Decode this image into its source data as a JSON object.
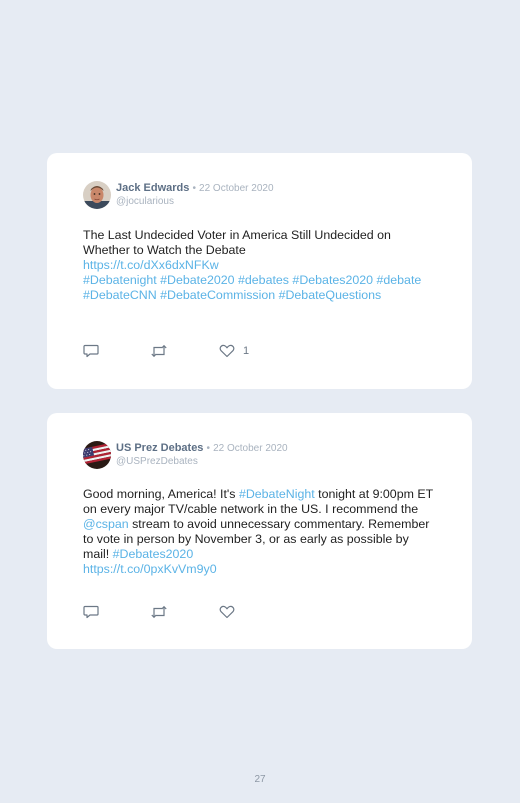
{
  "tweets": [
    {
      "name": "Jack Edwards",
      "separator": "•",
      "date": "22 October 2020",
      "handle": "@jocularious",
      "avatar_icon": "person-photo-icon",
      "segments": [
        {
          "text": "The Last Undecided Voter in America Still Undecided on Whether to Watch the Debate ",
          "link": false
        },
        {
          "text": "https://t.co/dXx6dxNFKw",
          "link": true,
          "br_before": true
        },
        {
          "text": "#Debatenight #Debate2020 #debates #Debates2020 #debate #DebateCNN #DebateCommission #DebateQuestions",
          "link": true,
          "br_before": true
        }
      ],
      "like_count": "1"
    },
    {
      "name": "US Prez Debates",
      "separator": "•",
      "date": "22 October 2020",
      "handle": "@USPrezDebates",
      "avatar_icon": "american-flag-icon",
      "segments": [
        {
          "text": "Good morning, America! It's ",
          "link": false
        },
        {
          "text": "#DebateNight",
          "link": true
        },
        {
          "text": " tonight at 9:00pm ET on every major TV/cable network in the US. I recommend the ",
          "link": false
        },
        {
          "text": "@cspan",
          "link": true
        },
        {
          "text": " stream to avoid unnecessary commentary. Remember to vote in person by November 3, or as early as possible by mail! ",
          "link": false
        },
        {
          "text": "#Debates2020",
          "link": true
        },
        {
          "text": "https://t.co/0pxKvVm9y0",
          "link": true,
          "br_before": true
        }
      ],
      "like_count": ""
    }
  ],
  "icons": {
    "reply": "reply-icon",
    "retweet": "retweet-icon",
    "like": "heart-icon"
  },
  "colors": {
    "background": "#e6ebf3",
    "card": "#ffffff",
    "link": "#5bb3e6",
    "name": "#5d6f85",
    "meta": "#a9b3bf"
  },
  "page_number": "27"
}
